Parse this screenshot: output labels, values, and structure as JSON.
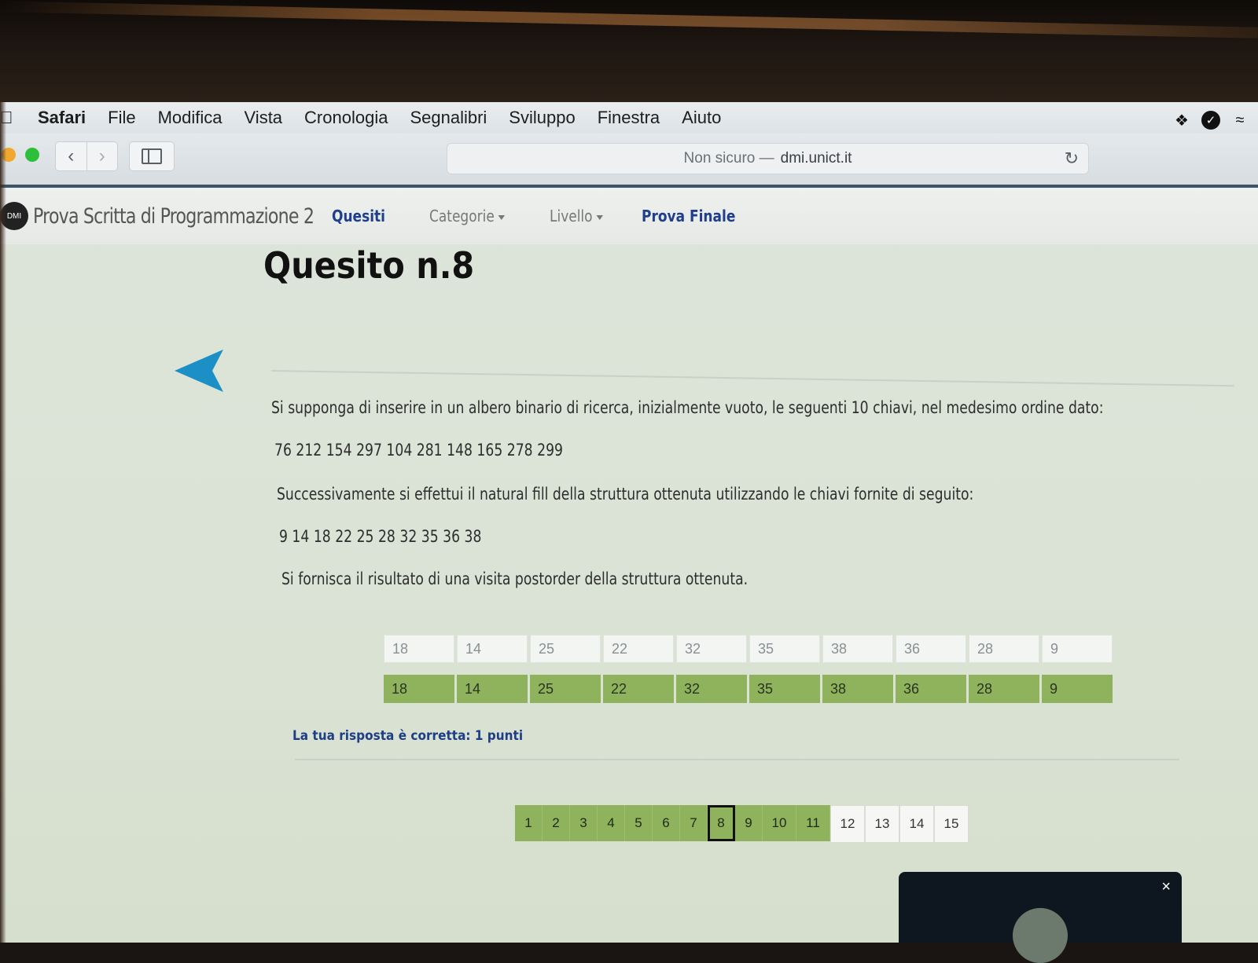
{
  "menubar": {
    "app": "Safari",
    "items": [
      "File",
      "Modifica",
      "Vista",
      "Cronologia",
      "Segnalibri",
      "Sviluppo",
      "Finestra",
      "Aiuto"
    ],
    "right_icons": [
      "dropbox-icon",
      "check-circle-icon",
      "creative-cloud-icon"
    ]
  },
  "toolbar": {
    "url_prefix": "Non sicuro —",
    "url_host": "dmi.unict.it"
  },
  "site": {
    "logo_text": "DMI",
    "brand": "Prova Scritta di Programmazione 2",
    "nav": {
      "quesiti": "Quesiti",
      "categorie": "Categorie",
      "livello": "Livello",
      "prova_finale": "Prova Finale"
    }
  },
  "question": {
    "title": "Quesito n.8",
    "p1": "Si supponga di inserire in un albero binario di ricerca, inizialmente vuoto, le seguenti 10 chiavi, nel medesimo ordine dato:",
    "keys1": "76 212 154 297 104 281 148 165 278 299",
    "p2": "Successivamente si effettui il natural fill della struttura ottenuta utilizzando le chiavi fornite di seguito:",
    "keys2": "9 14 18 22 25 28 32 35 36 38",
    "p3": "Si fornisca il risultato di una visita postorder della struttura ottenuta."
  },
  "answer_row": [
    "18",
    "14",
    "25",
    "22",
    "32",
    "35",
    "38",
    "36",
    "28",
    "9"
  ],
  "solution_row": [
    "18",
    "14",
    "25",
    "22",
    "32",
    "35",
    "38",
    "36",
    "28",
    "9"
  ],
  "result_text": "La tua risposta è corretta: 1 punti",
  "pagination": {
    "pages": [
      "1",
      "2",
      "3",
      "4",
      "5",
      "6",
      "7",
      "8",
      "9",
      "10",
      "11",
      "12",
      "13",
      "14",
      "15"
    ],
    "current": "8",
    "answered_through": 11
  },
  "popup": {
    "close": "×"
  },
  "colors": {
    "accent_nav": "#1f3f8c",
    "correct_green": "#8fb35d",
    "back_arrow": "#1c8fc7"
  }
}
